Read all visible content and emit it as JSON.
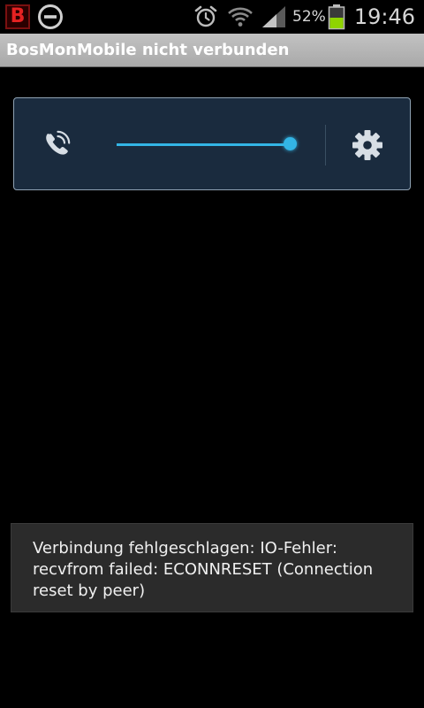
{
  "status_bar": {
    "notification_icons": [
      "app-b-icon",
      "do-not-disturb-icon"
    ],
    "system_icons": [
      "alarm-icon",
      "wifi-icon",
      "signal-icon",
      "battery-icon"
    ],
    "app_icon_letter": "B",
    "battery_percent": "52%",
    "battery_level": 0.52,
    "clock": "19:46"
  },
  "title_bar": {
    "title": "BosMonMobile nicht verbunden"
  },
  "control_panel": {
    "call_icon": "phone-call-icon",
    "volume_level": 1.0,
    "settings_icon": "gear-icon",
    "accent_color": "#33b5e5"
  },
  "toast": {
    "message": "Verbindung fehlgeschlagen: IO-Fehler: recvfrom failed: ECONNRESET (Connection reset by peer)"
  },
  "colors": {
    "background": "#000000",
    "panel_background": "#1a2b3e",
    "title_bar": "#b5b5b5",
    "toast_background": "#2b2b2b",
    "battery_green": "#8fd400",
    "app_icon_red": "#e52222"
  }
}
